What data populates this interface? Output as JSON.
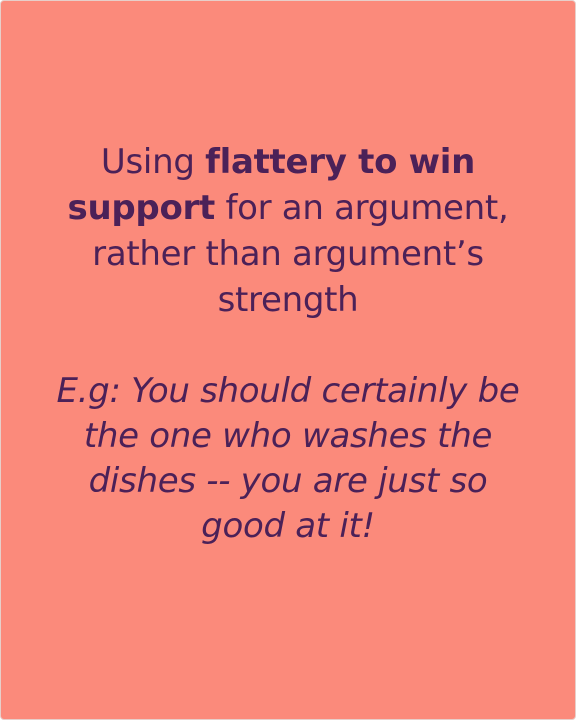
{
  "colors": {
    "background": "#fb8a7b",
    "text": "#4b2158"
  },
  "card": {
    "definition": {
      "part1": "Using ",
      "bold": "flattery to win support",
      "part2": " for an argument, rather than argument’s strength"
    },
    "example": "E.g: You should certainly be the one who washes the dishes -- you are just so good at it!"
  }
}
